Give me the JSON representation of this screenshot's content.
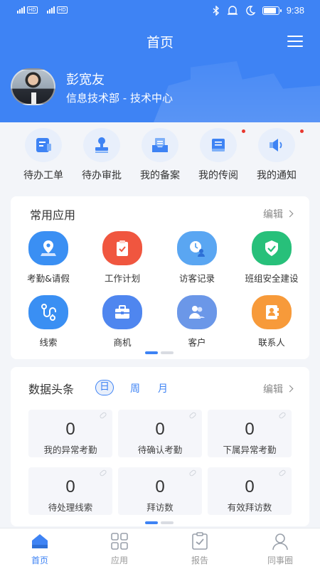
{
  "status_bar": {
    "time": "9:38",
    "signal_1": "4G HD",
    "signal_2": "4G HD"
  },
  "header": {
    "title": "首页"
  },
  "user": {
    "name": "彭宽友",
    "department": "信息技术部 - 技术中心"
  },
  "quick_actions": [
    {
      "label": "待办工单",
      "icon": "todo-ticket-icon",
      "badge": false
    },
    {
      "label": "待办审批",
      "icon": "approval-stamp-icon",
      "badge": false
    },
    {
      "label": "我的备案",
      "icon": "filing-tray-icon",
      "badge": false
    },
    {
      "label": "我的传阅",
      "icon": "book-icon",
      "badge": true
    },
    {
      "label": "我的通知",
      "icon": "speaker-icon",
      "badge": true
    }
  ],
  "common_apps": {
    "title": "常用应用",
    "edit_label": "编辑",
    "items": [
      {
        "label": "考勤&请假",
        "icon": "location-pin-icon",
        "color": "#3a8ff3"
      },
      {
        "label": "工作计划",
        "icon": "clipboard-check-icon",
        "color": "#f0563f"
      },
      {
        "label": "访客记录",
        "icon": "visitor-clock-icon",
        "color": "#5aa6f2"
      },
      {
        "label": "班组安全建设",
        "icon": "shield-check-icon",
        "color": "#27c07a"
      },
      {
        "label": "线索",
        "icon": "route-icon",
        "color": "#3a8ff3"
      },
      {
        "label": "商机",
        "icon": "briefcase-icon",
        "color": "#4f86ef"
      },
      {
        "label": "客户",
        "icon": "customers-icon",
        "color": "#6b97e8"
      },
      {
        "label": "联系人",
        "icon": "contact-book-icon",
        "color": "#f79a3a"
      }
    ]
  },
  "data_headlines": {
    "title": "数据头条",
    "edit_label": "编辑",
    "periods": [
      "日",
      "周",
      "月"
    ],
    "selected_period": "日",
    "stats": [
      {
        "value": "0",
        "label": "我的异常考勤"
      },
      {
        "value": "0",
        "label": "待确认考勤"
      },
      {
        "value": "0",
        "label": "下属异常考勤"
      },
      {
        "value": "0",
        "label": "待处理线索"
      },
      {
        "value": "0",
        "label": "拜访数"
      },
      {
        "value": "0",
        "label": "有效拜访数"
      }
    ]
  },
  "tab_bar": {
    "items": [
      {
        "label": "首页",
        "icon": "home-icon",
        "active": true
      },
      {
        "label": "应用",
        "icon": "apps-grid-icon",
        "active": false
      },
      {
        "label": "报告",
        "icon": "report-icon",
        "active": false
      },
      {
        "label": "同事圈",
        "icon": "colleague-icon",
        "active": false
      }
    ]
  },
  "colors": {
    "primary": "#3e83f4",
    "badge": "#e8382f",
    "background": "#f3f5f9"
  }
}
